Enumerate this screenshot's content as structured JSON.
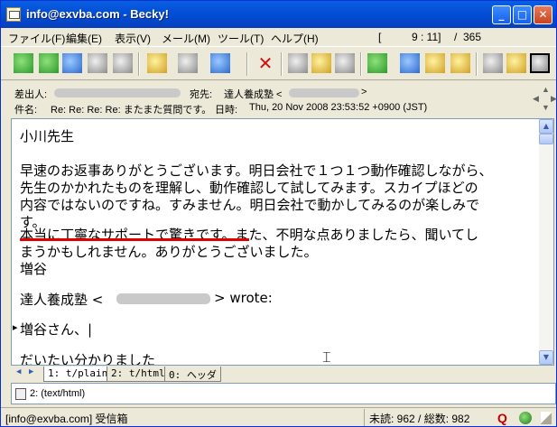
{
  "window": {
    "title": "info@exvba.com - Becky!"
  },
  "menu": [
    {
      "label": "ファイル(F)"
    },
    {
      "label": "編集(E)"
    },
    {
      "label": "表示(V)"
    },
    {
      "label": "メール(M)"
    },
    {
      "label": "ツール(T)"
    },
    {
      "label": "ヘルプ(H)"
    }
  ],
  "position": {
    "open": "[",
    "current": "9 : 11]",
    "slash": "/",
    "total": "365"
  },
  "header": {
    "from_label": "差出人:",
    "to_label": "宛先:",
    "to_value": "達人養成塾 <",
    "to_close": ">",
    "subject_label": "件名:",
    "subject_value": "Re: Re: Re: Re: またまた質問です。",
    "date_label": "日時:",
    "date_value": "Thu, 20 Nov 2008 23:53:52 +0900 (JST)"
  },
  "body": {
    "lines": [
      "小川先生",
      "",
      "早速のお返事ありがとうございます。明日会社で１つ１つ動作確認しながら、",
      "先生のかかれたものを理解し、動作確認して試してみます。スカイプほどの",
      "内容ではないのですね。すみません。明日会社で動かしてみるのが楽しみで",
      "す。",
      "本当に丁寧なサポートで驚きです。また、不明な点ありましたら、聞いてし",
      "まうかもしれません。ありがとうございました。",
      "増谷",
      "",
      "達人養成塾 <",
      "",
      "増谷さん、|",
      "",
      "だいたい分かりました"
    ],
    "wrote_suffix": "> wrote:",
    "quote_marker": "▸"
  },
  "tabs": {
    "prev": "◀",
    "next": "▶",
    "items": [
      {
        "label": "1: t/plain"
      },
      {
        "label": "2: t/html"
      },
      {
        "label": "0: ヘッダ"
      }
    ]
  },
  "attachment": {
    "label": "2: (text/html)"
  },
  "status": {
    "account": "[info@exvba.com] 受信箱",
    "unread": "未読: 962 / 総数: 982"
  },
  "colors": {
    "title_bg": "#0350d8",
    "underline": "#e00000",
    "chrome": "#ece9d8"
  }
}
